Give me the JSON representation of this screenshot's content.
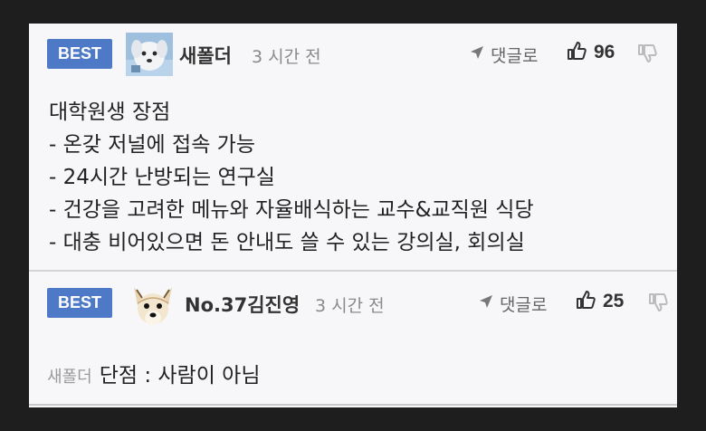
{
  "comments": [
    {
      "badge": "BEST",
      "username": "새폴더",
      "time": "3 시간 전",
      "reply_label": "댓글로",
      "likes": "96",
      "body": [
        "대학원생 장점",
        "- 온갖 저널에 접속 가능",
        "- 24시간 난방되는 연구실",
        "- 건강을 고려한 메뉴와 자율배식하는 교수&교직원 식당",
        "- 대충 비어있으면 돈 안내도 쓸 수 있는 강의실, 회의실"
      ]
    },
    {
      "badge": "BEST",
      "username": "No.37김진영",
      "time": "3 시간 전",
      "reply_label": "댓글로",
      "likes": "25",
      "mention": "새폴더",
      "body_text": "단점 : 사람이 아님"
    }
  ],
  "colors": {
    "badge": "#4d79c7",
    "background": "#1e1e1e",
    "panel": "#f7f7f9"
  },
  "icons": [
    "avatar-dog-icon",
    "reply-arrow-icon",
    "thumbs-up-icon",
    "thumbs-down-icon",
    "avatar-chihuahua-icon"
  ]
}
